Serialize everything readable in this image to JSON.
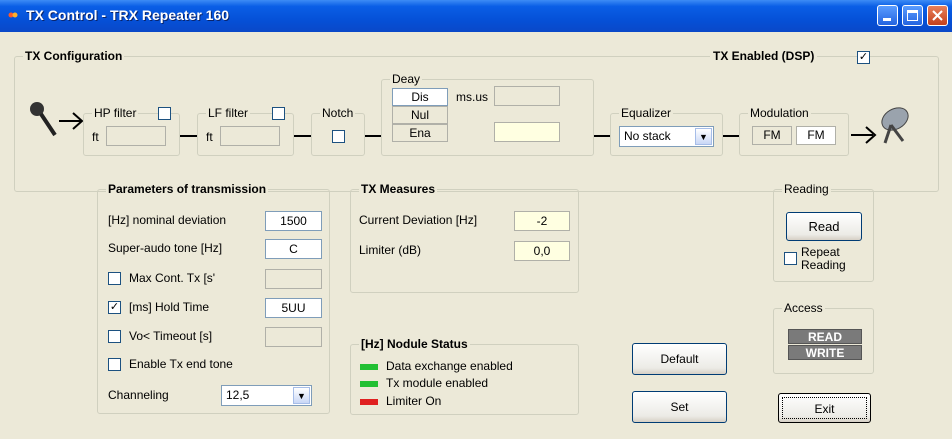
{
  "window": {
    "title": "TX Control - TRX Repeater 160"
  },
  "tx_config": {
    "label": "TX Configuration",
    "tx_enabled_label": "TX Enabled (DSP)",
    "tx_enabled_checked": true,
    "hp_filter": {
      "label": "HP filter",
      "ft_label": "ft",
      "ft_value": ""
    },
    "lf_filter": {
      "label": "LF filter",
      "ft_label": "ft",
      "ft_value": ""
    },
    "notch": {
      "label": "Notch"
    },
    "delay": {
      "label": "Deay",
      "btn_dis": "Dis",
      "btn_nul": "Nul",
      "btn_ena": "Ena",
      "unit_label": "ms.us",
      "value_top": "",
      "value_bottom": ""
    },
    "equalizer": {
      "label": "Equalizer",
      "value": "No stack"
    },
    "modulation": {
      "label": "Modulation",
      "left": "FM",
      "right": "FM"
    }
  },
  "params": {
    "label": "Parameters of transmission",
    "nominal_deviation_label": "[Hz] nominal deviation",
    "nominal_deviation_value": "1500",
    "superaudio_label": "Super-audo tone [Hz]",
    "superaudio_value": "C",
    "max_cont_label": "Max Cont. Tx [s'",
    "max_cont_checked": false,
    "max_cont_value": "",
    "hold_time_label": "[ms] Hold Time",
    "hold_time_checked": true,
    "hold_time_value": "5UU",
    "vox_label": "Vo< Timeout [s]",
    "vox_checked": false,
    "vox_value": "",
    "end_tone_label": "Enable Tx end tone",
    "end_tone_checked": false,
    "channeling_label": "Channeling",
    "channeling_value": "12,5"
  },
  "measures": {
    "label": "TX Measures",
    "deviation_label": "Current Deviation [Hz]",
    "deviation_value": "-2",
    "limiter_label": "Limiter (dB)",
    "limiter_value": "0,0"
  },
  "module_status": {
    "label": "[Hz] Nodule Status",
    "items": [
      {
        "label": "Data exchange enabled",
        "color": "#22c033"
      },
      {
        "label": "Tx module enabled",
        "color": "#22c033"
      },
      {
        "label": "Limiter On",
        "color": "#e02020"
      }
    ]
  },
  "reading": {
    "label": "Reading",
    "read_button": "Read",
    "repeat_label_1": "Repeat",
    "repeat_label_2": "Reading",
    "repeat_checked": false
  },
  "access": {
    "label": "Access",
    "read": "READ",
    "write": "WRITE"
  },
  "buttons": {
    "default": "Default",
    "set": "Set",
    "exit": "Exit"
  },
  "glyphs": {
    "check": "✓",
    "arrow_down": "▼",
    "arrow_right": "→"
  }
}
